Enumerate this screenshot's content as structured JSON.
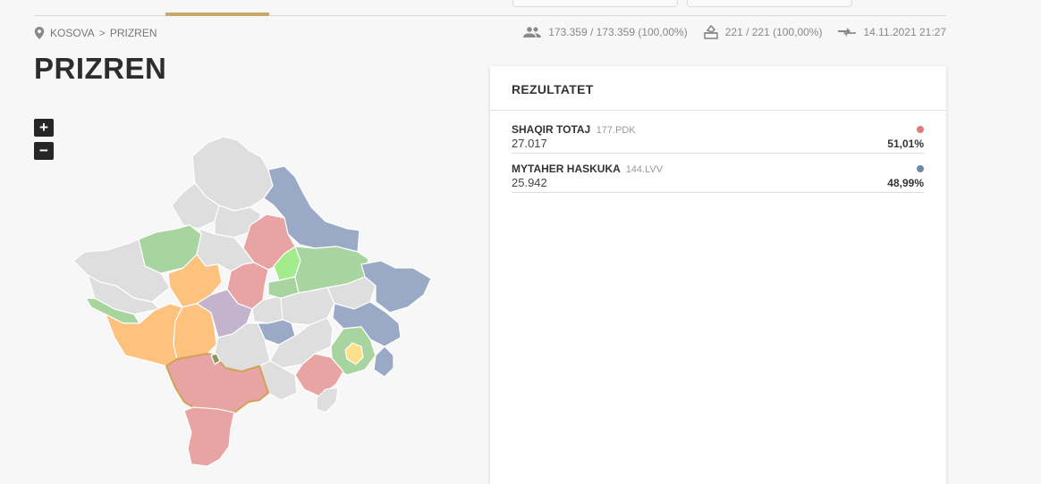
{
  "breadcrumb": {
    "root": "KOSOVA",
    "separator": ">",
    "current": "PRIZREN"
  },
  "stats": {
    "voters": "173.359 / 173.359 (100,00%)",
    "stations": "221 / 221 (100,00%)",
    "updated": "14.11.2021 21:27"
  },
  "page_title": "PRIZREN",
  "map_controls": {
    "zoom_in": "+",
    "zoom_out": "−"
  },
  "results": {
    "title": "REZULTATET",
    "candidates": [
      {
        "name": "SHAQIR TOTAJ",
        "party": "177.PDK",
        "votes": "27.017",
        "percent": "51,01%",
        "color": "#e07b7b"
      },
      {
        "name": "MYTAHER HASKUKA",
        "party": "144.LVV",
        "votes": "25.942",
        "percent": "48,99%",
        "color": "#6f87a8"
      }
    ]
  },
  "colors": {
    "accent": "#c8a96a",
    "pdk_red": "#e8a3a3",
    "lvv_blue": "#9aaac6",
    "ldk_green": "#a8d4a0",
    "aak_orange": "#fcc27e",
    "nisma_purple": "#c3b3cc",
    "neutral": "#dedede",
    "light_green": "#a2ec8c",
    "yellow": "#fde08a"
  }
}
